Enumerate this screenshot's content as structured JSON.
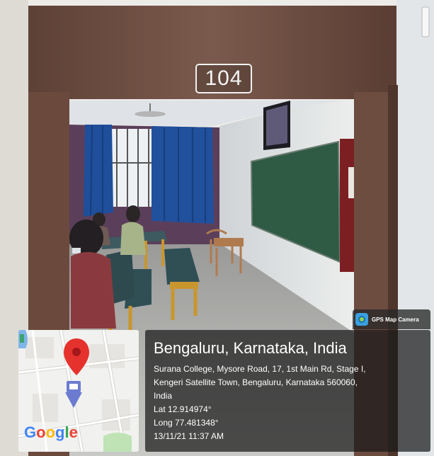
{
  "room": {
    "number": "104"
  },
  "badge": {
    "label": "GPS Map Camera",
    "icon": "gps-map-camera-icon"
  },
  "map": {
    "provider_logo": "Google",
    "pin_icon": "location-pin-icon"
  },
  "location": {
    "title": "Bengaluru, Karnataka, India",
    "address_lines": [
      "Surana College, Mysore Road, 17, 1st Main Rd, Stage I,",
      "Kengeri Satellite Town, Bengaluru, Karnataka 560060,",
      "India"
    ],
    "lat": "Lat 12.914974°",
    "long": "Long 77.481348°",
    "datetime": "13/11/21 11:37 AM"
  },
  "colors": {
    "door_frame": "#6a4a3c",
    "curtain": "#1f4e9a",
    "chalkboard": "#2f5a43",
    "wall_purple": "#5b3f5a",
    "map_pin": "#e5322d"
  }
}
